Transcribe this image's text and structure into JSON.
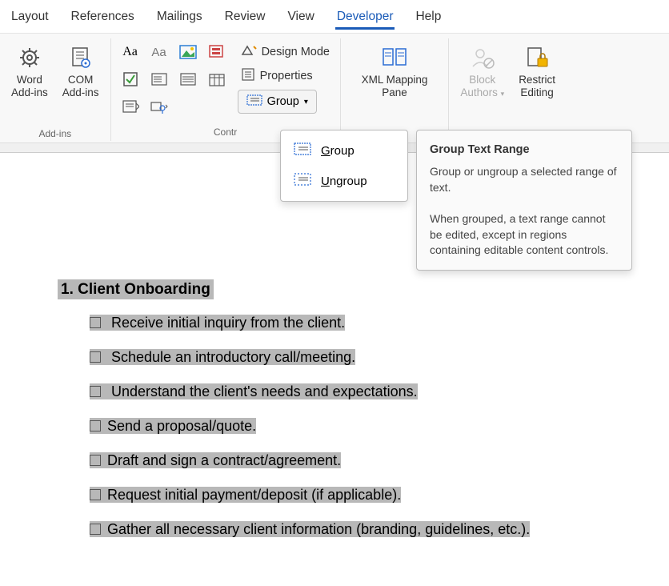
{
  "tabs": {
    "layout": "Layout",
    "references": "References",
    "mailings": "Mailings",
    "review": "Review",
    "view": "View",
    "developer": "Developer",
    "help": "Help"
  },
  "ribbon": {
    "addins": {
      "word": "Word\nAdd-ins",
      "com": "COM\nAdd-ins",
      "label": "Add-ins"
    },
    "controls": {
      "label": "Contr",
      "design_mode": "Design Mode",
      "properties": "Properties",
      "group": "Group"
    },
    "xml": {
      "label": "XML Mapping\nPane"
    },
    "protect": {
      "block": "Block\nAuthors",
      "restrict": "Restrict\nEditing"
    }
  },
  "dropdown": {
    "group": "Group",
    "ungroup": "Ungroup"
  },
  "tooltip": {
    "title": "Group Text Range",
    "p1": "Group or ungroup a selected range of text.",
    "p2": "When grouped, a text range cannot be edited, except in regions containing editable content controls."
  },
  "doc": {
    "heading": "1. Client Onboarding",
    "items": [
      " Receive initial inquiry from the client.",
      " Schedule an introductory call/meeting.",
      " Understand the client's needs and expectations.",
      "Send a proposal/quote.",
      "Draft and sign a contract/agreement.",
      "Request initial payment/deposit (if applicable).",
      "Gather all necessary client information (branding, guidelines, etc.)."
    ]
  }
}
